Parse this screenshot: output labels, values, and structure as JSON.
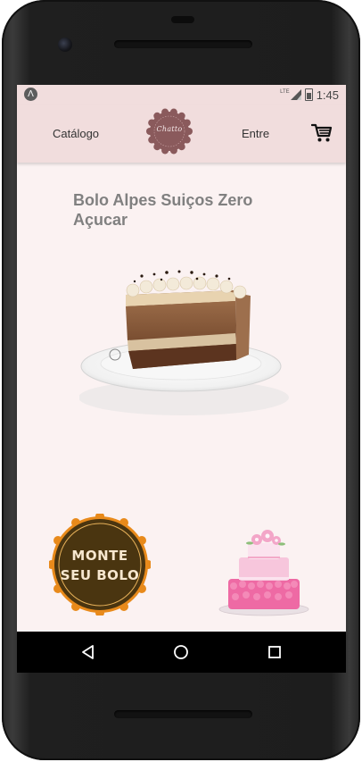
{
  "status_bar": {
    "time": "1:45",
    "network": "LTE",
    "app_icon": "expo-icon",
    "signal_icon": "signal-icon",
    "battery_icon": "battery-icon"
  },
  "header": {
    "catalog_link": "Catálogo",
    "login_link": "Entre",
    "logo_text": "Chatto",
    "cart_icon": "cart-icon"
  },
  "product": {
    "title": "Bolo Alpes Suiços Zero Açucar",
    "image": "cake-slice-image"
  },
  "promo": {
    "build_cake_line1": "MONTE",
    "build_cake_line2": "SEU BOLO",
    "tier_cake_image": "tier-cake-image"
  },
  "android_nav": {
    "back": "back-icon",
    "home": "home-icon",
    "recents": "recents-icon"
  },
  "colors": {
    "header_bg": "#f1dddd",
    "screen_bg": "#fbf2f2",
    "title_color": "#808080",
    "badge_dark": "#4a3510",
    "badge_orange": "#e88a1b",
    "logo_maroon": "#8a5a5c"
  }
}
